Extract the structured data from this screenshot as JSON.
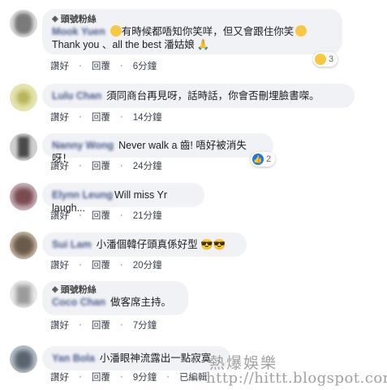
{
  "comments": [
    {
      "badge": "頭號粉絲",
      "name": "Mook Yuen",
      "text_a": "有時候都唔知你笑咩，但又會跟住你笑",
      "text_b": "Thank you 、all the best 潘姑娘",
      "reaction_count": "3",
      "like": "讚好",
      "reply": "回覆",
      "time": "6分鐘"
    },
    {
      "name": "Lulu Chan",
      "text_a": "須同商台再見呀，話時話，你會否刪埋臉書㗎。",
      "like": "讚好",
      "reply": "回覆",
      "time": "14分鐘"
    },
    {
      "name": "Nanny Wong",
      "text_a": "Never walk a 齒! 唔好被消失呀！",
      "reaction_count": "2",
      "like": "讚好",
      "reply": "回覆",
      "time": "24分鐘"
    },
    {
      "name": "Elynn Leung",
      "text_a": "Will miss Yr laugh...",
      "like": "讚好",
      "reply": "回覆",
      "time": "21分鐘"
    },
    {
      "name": "Sui Lam",
      "text_a": "小潘個韓仔頭真係好型",
      "like": "讚好",
      "reply": "回覆",
      "time": "20分鐘"
    },
    {
      "badge": "頭號粉絲",
      "name": "Coco Chan",
      "text_a": "做客席主持。",
      "like": "讚好",
      "reply": "回覆",
      "time": "7分鐘"
    },
    {
      "name": "Yan Bola",
      "text_a": "小潘眼神流露出一點寂寞",
      "like": "讚好",
      "reply": "回覆",
      "time": "9分鐘",
      "edited": "已編輯"
    }
  ],
  "watermark": {
    "title": "熱爆娛樂",
    "url": "http://hittt.blogspot.com"
  },
  "colors": {
    "bubble": "#f0f2f5",
    "like_blue": "#1877f2",
    "emoji_yellow": "#f7c843"
  }
}
